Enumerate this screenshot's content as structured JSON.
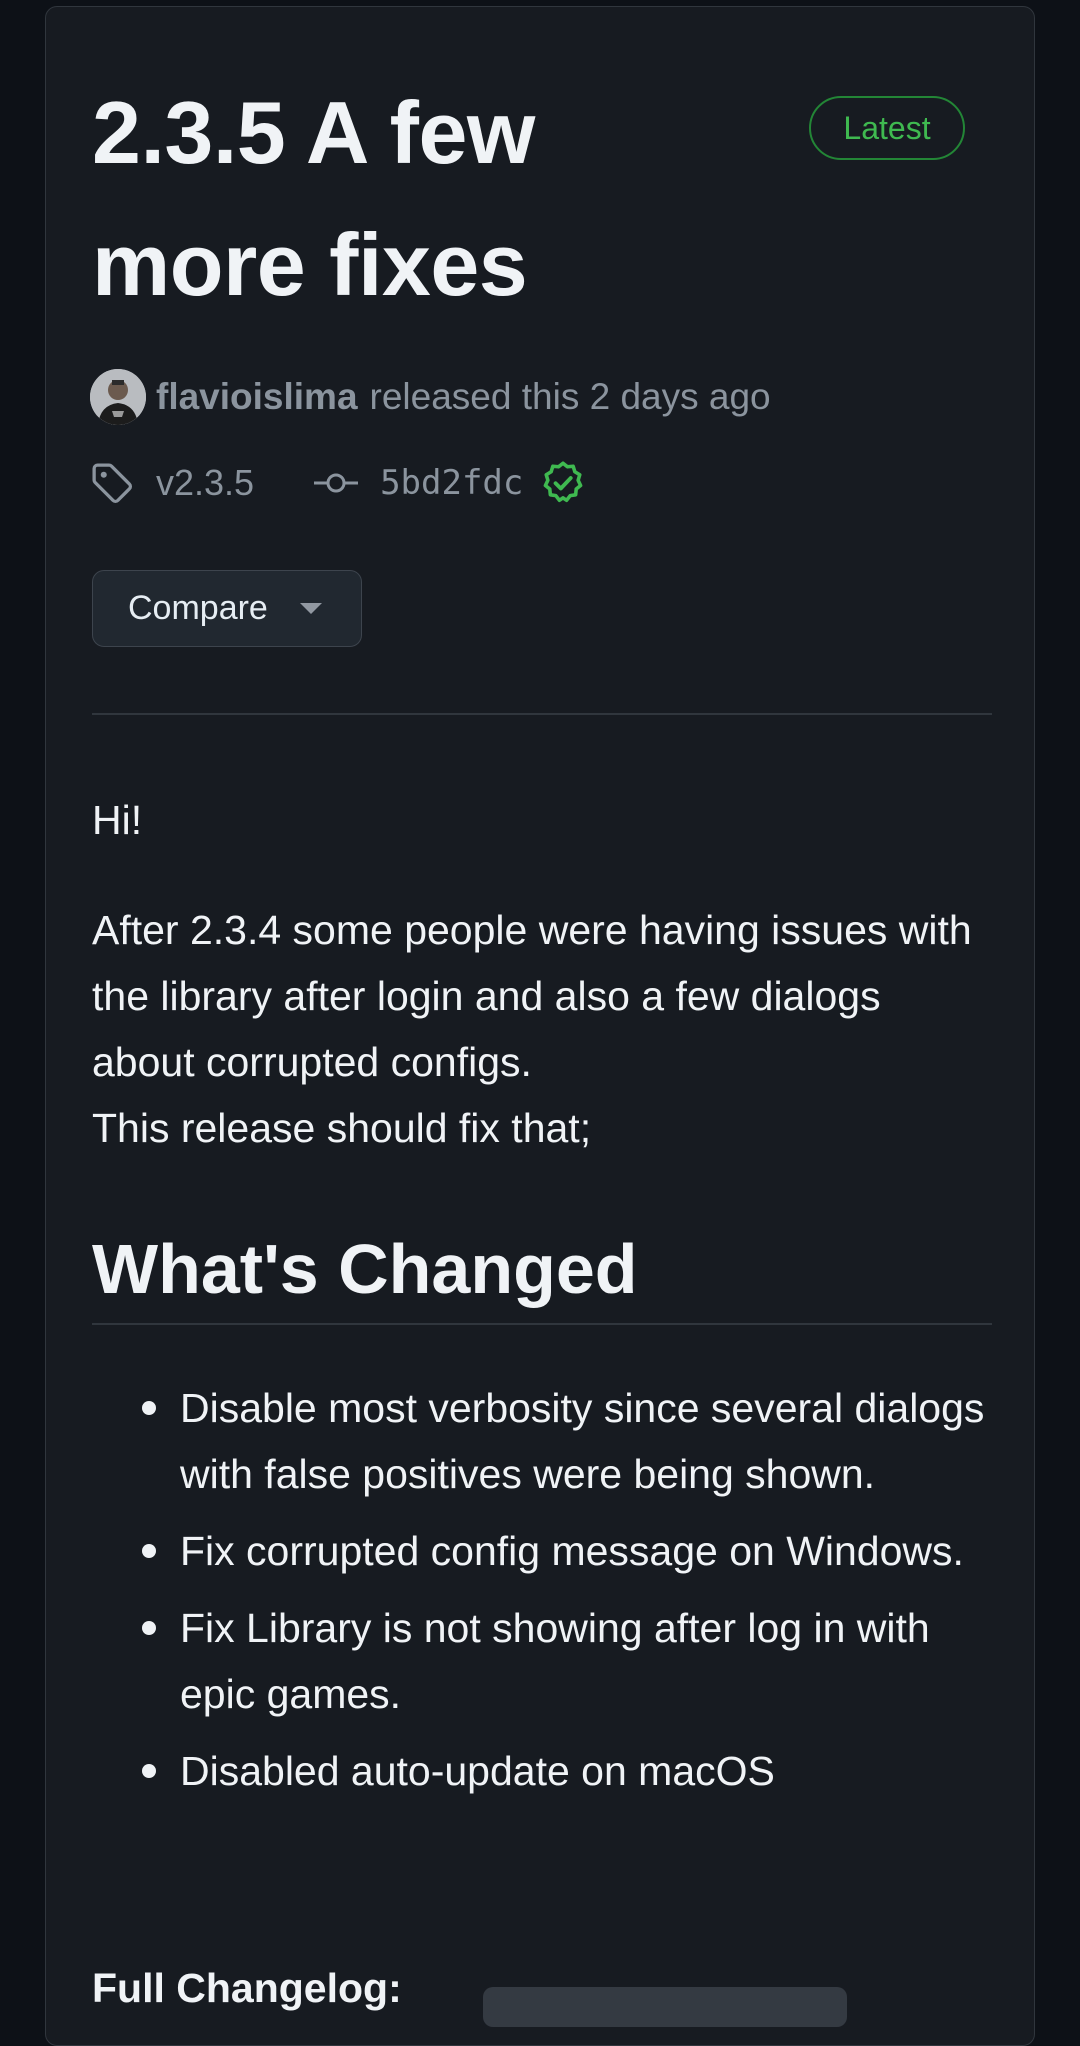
{
  "release": {
    "title": "2.3.5 A few more fixes",
    "badge": "Latest",
    "author": "flavioislima",
    "released_text": "released this 2 days ago",
    "tag": "v2.3.5",
    "commit": "5bd2fdc",
    "compare_label": "Compare"
  },
  "notes": {
    "greeting": "Hi!",
    "paragraph_line1": "After 2.3.4 some people were having issues with the library after login and also a few dialogs about corrupted configs.",
    "paragraph_line2": "This release should fix that;",
    "heading": "What's Changed",
    "changes": [
      "Disable most verbosity since several dialogs with false positives were being shown.",
      "Fix corrupted config message on Windows.",
      "Fix Library is not showing after log in with epic games.",
      "Disabled auto-update on macOS"
    ],
    "full_changelog_label": "Full Changelog:"
  },
  "colors": {
    "background": "#0d1117",
    "card": "#171b21",
    "latest_green": "#3fb950",
    "muted_text": "#8b949e"
  },
  "icons": {
    "tag": "tag-icon",
    "commit": "git-commit-icon",
    "verified": "verified-badge-icon",
    "compare_caret": "triangle-down-icon"
  }
}
